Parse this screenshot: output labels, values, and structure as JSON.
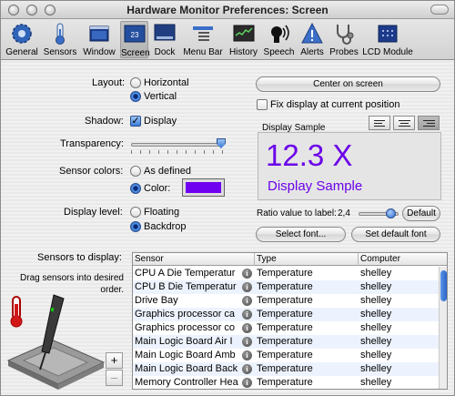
{
  "window": {
    "title": "Hardware Monitor Preferences: Screen"
  },
  "toolbar": {
    "items": [
      {
        "label": "General",
        "icon": "gear-icon"
      },
      {
        "label": "Sensors",
        "icon": "thermometer-icon"
      },
      {
        "label": "Window",
        "icon": "window-icon"
      },
      {
        "label": "Screen",
        "icon": "screen-icon",
        "badge": "23",
        "selected": true
      },
      {
        "label": "Dock",
        "icon": "dock-icon"
      },
      {
        "label": "Menu Bar",
        "icon": "menu-bar-icon"
      },
      {
        "label": "History",
        "icon": "history-icon"
      },
      {
        "label": "Speech",
        "icon": "speech-icon"
      },
      {
        "label": "Alerts",
        "icon": "alert-icon"
      },
      {
        "label": "Probes",
        "icon": "stethoscope-icon"
      },
      {
        "label": "LCD Module",
        "icon": "lcd-icon"
      }
    ]
  },
  "settings": {
    "layout_label": "Layout:",
    "layout_horizontal": "Horizontal",
    "layout_vertical": "Vertical",
    "shadow_label": "Shadow:",
    "shadow_display": "Display",
    "transparency_label": "Transparency:",
    "transparency_level": 0.97,
    "sensor_colors_label": "Sensor colors:",
    "colors_as_defined": "As defined",
    "colors_color": "Color:",
    "color_swatch": "#7000f0",
    "display_level_label": "Display level:",
    "level_floating": "Floating",
    "level_backdrop": "Backdrop"
  },
  "right_panel": {
    "center_button": "Center on screen",
    "fix_display": "Fix display at current position",
    "sample_title": "Display Sample",
    "sample_value": "12.3 X",
    "sample_label": "Display Sample",
    "sample_color": "#6a00e8",
    "ratio_label": "Ratio value to label:",
    "ratio_value": "2,4",
    "ratio_level": 0.8,
    "default_button": "Default",
    "select_font_button": "Select font...",
    "default_font_button": "Set default font"
  },
  "sensors": {
    "label": "Sensors to display:",
    "hint": "Drag sensors into desired order.",
    "columns": [
      "Sensor",
      "Type",
      "Computer"
    ],
    "rows": [
      {
        "sensor": "CPU A Die Temperatur",
        "type": "Temperature",
        "computer": "shelley"
      },
      {
        "sensor": "CPU B Die Temperatur",
        "type": "Temperature",
        "computer": "shelley"
      },
      {
        "sensor": "Drive Bay",
        "type": "Temperature",
        "computer": "shelley"
      },
      {
        "sensor": "Graphics processor ca",
        "type": "Temperature",
        "computer": "shelley"
      },
      {
        "sensor": "Graphics processor co",
        "type": "Temperature",
        "computer": "shelley"
      },
      {
        "sensor": "Main Logic Board Air I",
        "type": "Temperature",
        "computer": "shelley"
      },
      {
        "sensor": "Main Logic Board Amb",
        "type": "Temperature",
        "computer": "shelley"
      },
      {
        "sensor": "Main Logic Board Back",
        "type": "Temperature",
        "computer": "shelley"
      },
      {
        "sensor": "Memory Controller Hea",
        "type": "Temperature",
        "computer": "shelley"
      }
    ],
    "add_button": "+",
    "remove_button": "–"
  }
}
